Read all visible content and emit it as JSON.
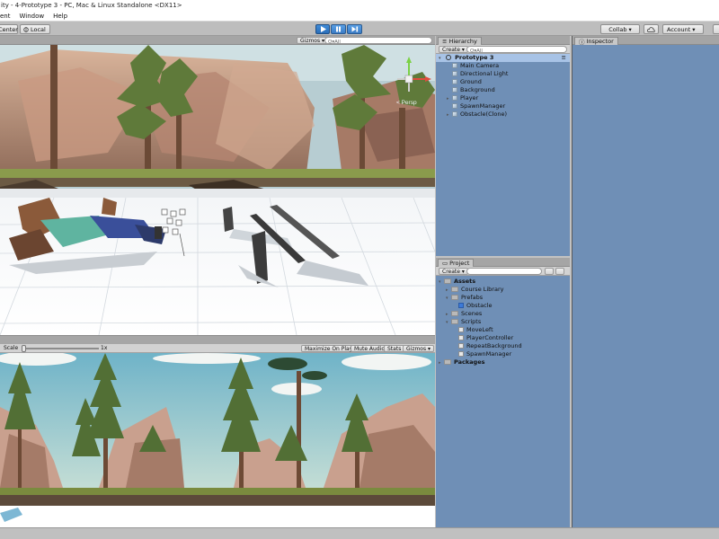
{
  "window": {
    "title": "ity - 4-Prototype 3 - PC, Mac & Linux Standalone <DX11>"
  },
  "menu": {
    "items": [
      "ent",
      "Window",
      "Help"
    ]
  },
  "toolbar": {
    "pivot_center": "Center",
    "pivot_local": "Local",
    "play_icon": "play-icon",
    "pause_icon": "pause-icon",
    "step_icon": "step-icon",
    "collab": "Collab ▾",
    "account": "Account ▾"
  },
  "scene": {
    "gizmos": "Gizmos ▾",
    "persp_label": "< Persp"
  },
  "game": {
    "scale_label": "Scale",
    "scale_value": "1x",
    "maximize": "Maximize On Play",
    "mute": "Mute Audio",
    "stats": "Stats",
    "gizmos": "Gizmos ▾",
    "scale_fraction": 0.0
  },
  "hierarchy": {
    "tab": "Hierarchy",
    "create": "Create ▾",
    "search_placeholder": "Q▾All",
    "scene_name": "Prototype 3",
    "items": [
      {
        "label": "Main Camera",
        "expand": false
      },
      {
        "label": "Directional Light",
        "expand": false
      },
      {
        "label": "Ground",
        "expand": false
      },
      {
        "label": "Background",
        "expand": false
      },
      {
        "label": "Player",
        "expand": true
      },
      {
        "label": "SpawnManager",
        "expand": false
      },
      {
        "label": "Obstacle(Clone)",
        "expand": true
      }
    ]
  },
  "project": {
    "tab": "Project",
    "create": "Create ▾",
    "tree": [
      {
        "label": "Assets",
        "level": 0,
        "type": "folder",
        "arrow": "▾"
      },
      {
        "label": "Course Library",
        "level": 1,
        "type": "folder",
        "arrow": "▸"
      },
      {
        "label": "Prefabs",
        "level": 1,
        "type": "folder",
        "arrow": "▾"
      },
      {
        "label": "Obstacle",
        "level": 2,
        "type": "prefab",
        "arrow": ""
      },
      {
        "label": "Scenes",
        "level": 1,
        "type": "folder",
        "arrow": "▸"
      },
      {
        "label": "Scripts",
        "level": 1,
        "type": "folder",
        "arrow": "▾"
      },
      {
        "label": "MoveLeft",
        "level": 2,
        "type": "script",
        "arrow": ""
      },
      {
        "label": "PlayerController",
        "level": 2,
        "type": "script",
        "arrow": ""
      },
      {
        "label": "RepeatBackground",
        "level": 2,
        "type": "script",
        "arrow": ""
      },
      {
        "label": "SpawnManager",
        "level": 2,
        "type": "script",
        "arrow": ""
      },
      {
        "label": "Packages",
        "level": 0,
        "type": "folder",
        "arrow": "▸"
      }
    ]
  },
  "inspector": {
    "tab": "Inspector"
  },
  "colors": {
    "accent": "#3b7cc4",
    "panel": "#c2c2c2",
    "sky": "#7fb8c9"
  }
}
